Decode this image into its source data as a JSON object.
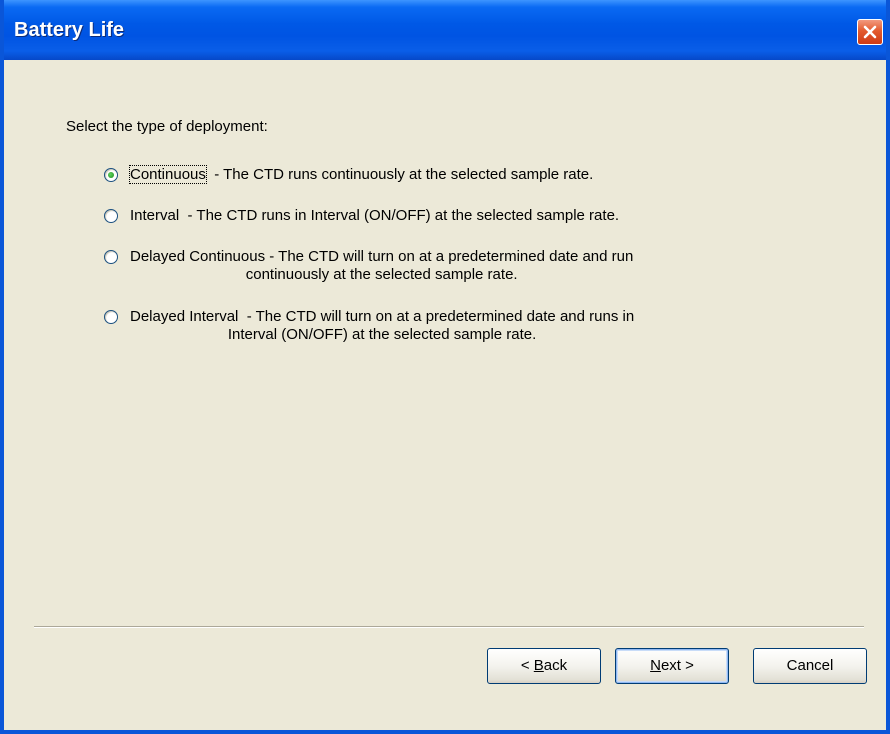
{
  "window": {
    "title": "Battery Life"
  },
  "prompt": "Select the type of deployment:",
  "options": [
    {
      "name": "Continuous",
      "desc1": "  - The CTD runs continuously at the selected sample rate.",
      "desc2": "",
      "selected": true
    },
    {
      "name": "Interval",
      "desc1": "  - The CTD runs in Interval (ON/OFF) at the selected sample rate.",
      "desc2": "",
      "selected": false
    },
    {
      "name": "Delayed Continuous",
      "desc1": " - The CTD will turn on at a predetermined date and run",
      "desc2": "continuously at the selected sample rate.",
      "selected": false
    },
    {
      "name": "Delayed Interval",
      "desc1": "  - The CTD will turn on at a predetermined date and runs in",
      "desc2": "Interval (ON/OFF) at the selected sample rate.",
      "selected": false
    }
  ],
  "buttons": {
    "back": {
      "prefix": "< ",
      "mnemonic": "B",
      "rest": "ack"
    },
    "next": {
      "prefix": "",
      "mnemonic": "N",
      "rest": "ext >"
    },
    "cancel": "Cancel"
  },
  "colors": {
    "title_bar": "#0054e3",
    "window_bg": "#ece9d8",
    "close_button": "#e35b2e",
    "radio_selected": "#21a121"
  },
  "icons": {
    "close": "close-icon"
  }
}
